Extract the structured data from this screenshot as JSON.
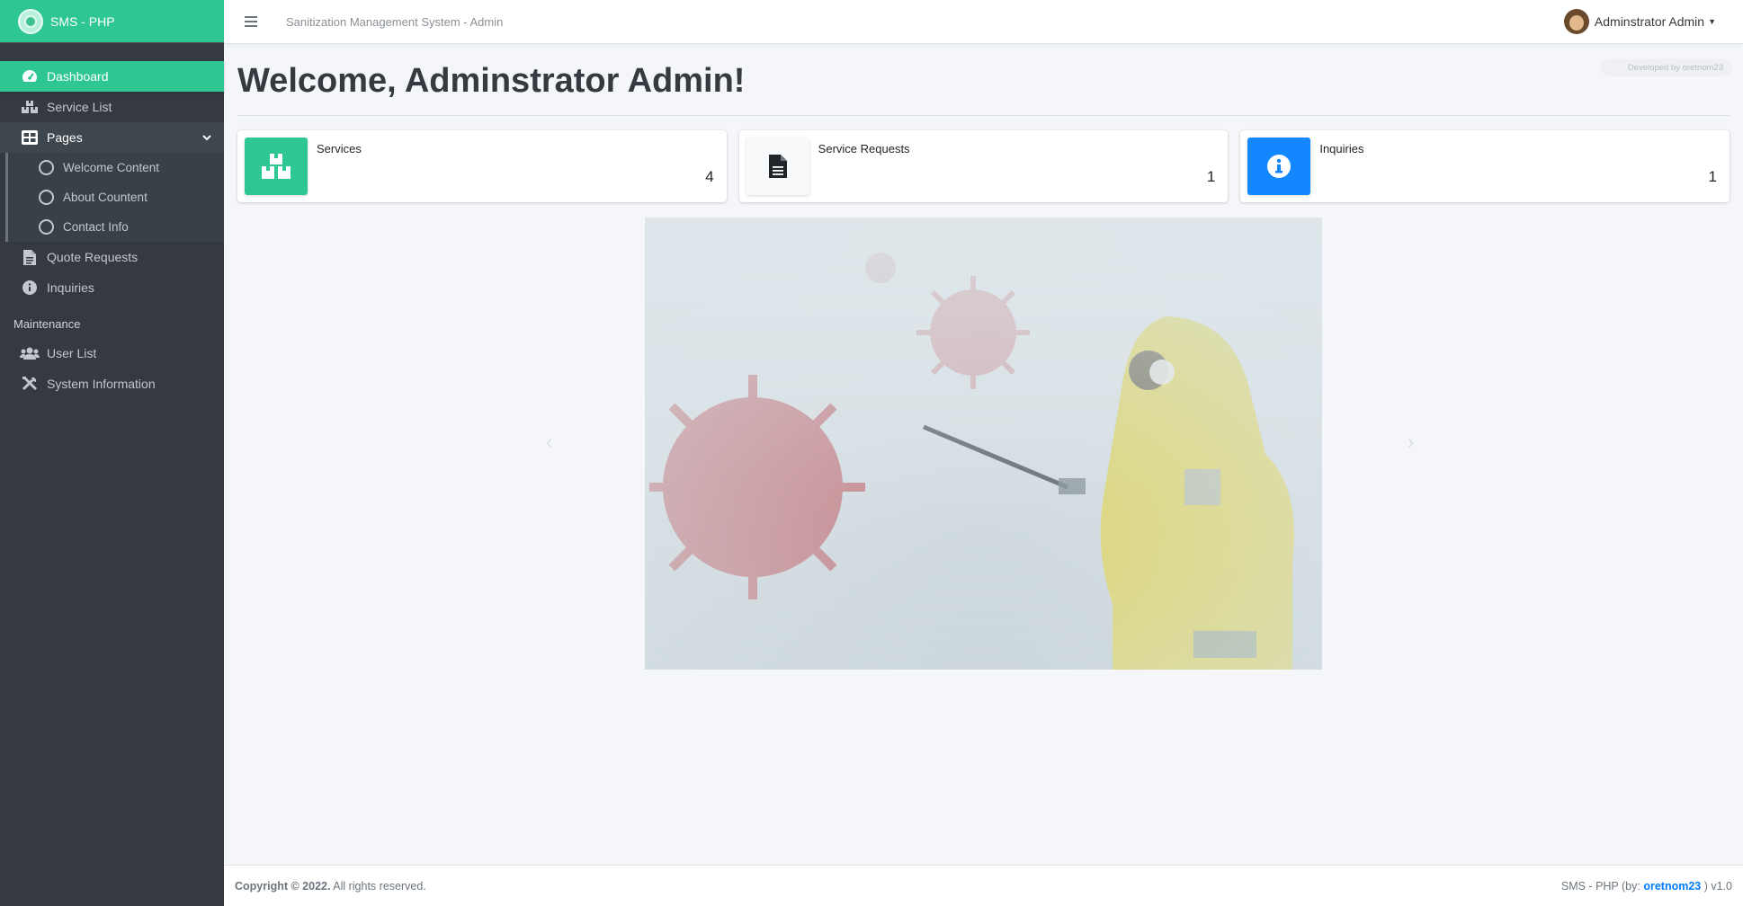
{
  "brand": {
    "name": "SMS - PHP"
  },
  "sidebar": {
    "items": [
      {
        "label": "Dashboard",
        "icon": "tachometer-icon"
      },
      {
        "label": "Service List",
        "icon": "boxes-icon"
      },
      {
        "label": "Pages",
        "icon": "th-large-icon"
      },
      {
        "label": "Welcome Content",
        "icon": "circle-icon"
      },
      {
        "label": "About Countent",
        "icon": "circle-icon"
      },
      {
        "label": "Contact Info",
        "icon": "circle-icon"
      },
      {
        "label": "Quote Requests",
        "icon": "file-icon"
      },
      {
        "label": "Inquiries",
        "icon": "info-circle-icon"
      }
    ],
    "maintenance_header": "Maintenance",
    "maintenance": [
      {
        "label": "User List",
        "icon": "users-icon"
      },
      {
        "label": "System Information",
        "icon": "tools-icon"
      }
    ]
  },
  "topbar": {
    "title": "Sanitization Management System - Admin",
    "user": "Adminstrator Admin"
  },
  "main": {
    "dev_badge": "Developed by oretnom23",
    "welcome": "Welcome, Adminstrator Admin!",
    "cards": [
      {
        "label": "Services",
        "value": "4",
        "color": "#2ec794"
      },
      {
        "label": "Service Requests",
        "value": "1",
        "color": "#f8f9fa"
      },
      {
        "label": "Inquiries",
        "value": "1",
        "color": "#1287ff"
      }
    ]
  },
  "footer": {
    "copyright_bold": "Copyright © 2022.",
    "copyright_rest": " All rights reserved.",
    "right_prefix": "SMS - PHP (by: ",
    "right_link": "oretnom23",
    "right_suffix": " ) v1.0"
  },
  "colors": {
    "accent": "#2ec794",
    "sidebar": "#343a40",
    "info": "#1287ff"
  }
}
